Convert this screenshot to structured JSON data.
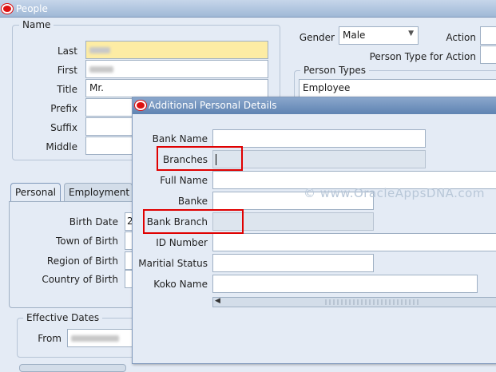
{
  "window": {
    "title": "People"
  },
  "name_group": {
    "title": "Name",
    "last_label": "Last",
    "first_label": "First",
    "title_label": "Title",
    "title_value": "Mr.",
    "prefix_label": "Prefix",
    "suffix_label": "Suffix",
    "middle_label": "Middle"
  },
  "header": {
    "gender_label": "Gender",
    "gender_value": "Male",
    "action_label": "Action",
    "person_type_action_label": "Person Type for Action"
  },
  "person_types": {
    "title": "Person Types",
    "value": "Employee"
  },
  "tabs": [
    {
      "label": "Personal"
    },
    {
      "label": "Employment"
    }
  ],
  "personal": {
    "birth_date_label": "Birth Date",
    "birth_date_value": "2",
    "town_label": "Town of Birth",
    "region_label": "Region of Birth",
    "country_label": "Country of Birth"
  },
  "effective": {
    "title": "Effective Dates",
    "from_label": "From"
  },
  "dialog": {
    "title": "Additional Personal Details",
    "bank_name_label": "Bank Name",
    "branches_label": "Branches",
    "full_name_label": "Full Name",
    "banke_label": "Banke",
    "bank_branch_label": "Bank Branch",
    "id_number_label": "ID Number",
    "maritial_status_label": "Maritial Status",
    "koko_name_label": "Koko Name"
  },
  "watermark": "© www.OracleAppsDNA.com",
  "colors": {
    "highlight_field": "#fdeca4",
    "annotation": "#e00000",
    "dialog_title": "#6d8fbd"
  }
}
